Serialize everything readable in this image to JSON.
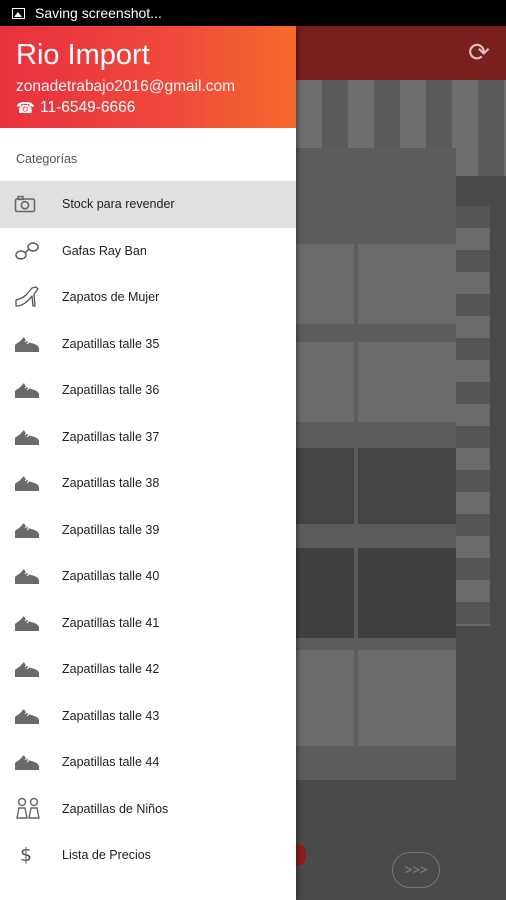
{
  "status_bar": {
    "text": "Saving screenshot..."
  },
  "drawer": {
    "brand": "Rio Import",
    "email": "zonadetrabajo2016@gmail.com",
    "phone": "11-6549-6666",
    "section_label": "Categorías",
    "items": [
      {
        "label": "Stock para revender",
        "icon": "camera-icon",
        "active": true
      },
      {
        "label": "Gafas Ray Ban",
        "icon": "glasses-icon"
      },
      {
        "label": "Zapatos de Mujer",
        "icon": "high-heel-icon"
      },
      {
        "label": "Zapatillas talle 35",
        "icon": "sneaker-icon"
      },
      {
        "label": "Zapatillas talle 36",
        "icon": "sneaker-icon"
      },
      {
        "label": "Zapatillas talle 37",
        "icon": "sneaker-icon"
      },
      {
        "label": "Zapatillas talle 38",
        "icon": "sneaker-icon"
      },
      {
        "label": "Zapatillas talle 39",
        "icon": "sneaker-icon"
      },
      {
        "label": "Zapatillas talle 40",
        "icon": "sneaker-icon"
      },
      {
        "label": "Zapatillas talle 41",
        "icon": "sneaker-icon"
      },
      {
        "label": "Zapatillas talle 42",
        "icon": "sneaker-icon"
      },
      {
        "label": "Zapatillas talle 43",
        "icon": "sneaker-icon"
      },
      {
        "label": "Zapatillas talle 44",
        "icon": "sneaker-icon"
      },
      {
        "label": "Zapatillas de Niños",
        "icon": "kids-icon"
      },
      {
        "label": "Lista de Precios",
        "icon": "dollar-icon"
      }
    ]
  },
  "background": {
    "next_label": ">>>"
  },
  "colors": {
    "header_start": "#e8313f",
    "header_end": "#f56a2a",
    "active_item": "#e0e0e0"
  }
}
